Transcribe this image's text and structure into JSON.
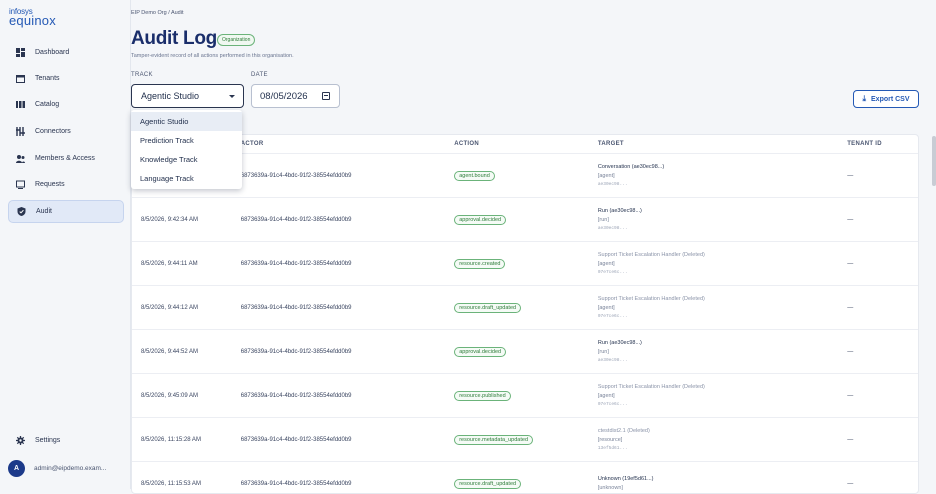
{
  "logo": {
    "line1": "infosys",
    "line2": "equinox"
  },
  "sidebar": {
    "items": [
      {
        "label": "Dashboard",
        "icon": "dashboard-icon"
      },
      {
        "label": "Tenants",
        "icon": "tenants-icon"
      },
      {
        "label": "Catalog",
        "icon": "catalog-icon"
      },
      {
        "label": "Connectors",
        "icon": "connectors-icon"
      },
      {
        "label": "Members & Access",
        "icon": "members-icon"
      },
      {
        "label": "Requests",
        "icon": "requests-icon"
      },
      {
        "label": "Audit",
        "icon": "shield-icon",
        "active": true
      }
    ],
    "settings": "Settings",
    "user": {
      "initial": "A",
      "email": "admin@eipdemo.exam..."
    }
  },
  "breadcrumb": "EIP Demo Org  /  Audit",
  "page": {
    "title": "Audit Log",
    "badge": "Organization",
    "subtitle": "Tamper-evident record of all actions performed in this organisation."
  },
  "filters": {
    "track_label": "TRACK",
    "track_value": "Agentic Studio",
    "date_label": "DATE",
    "date_value": "08/05/2026",
    "track_options": [
      "Agentic Studio",
      "Prediction Track",
      "Knowledge Track",
      "Language Track"
    ]
  },
  "export_label": "Export CSV",
  "table": {
    "headers": {
      "actor": "ACTOR",
      "action": "ACTION",
      "target": "TARGET",
      "tenant": "TENANT ID"
    },
    "rows": [
      {
        "time": "",
        "actor": "6873639a-91c4-4bdc-91f2-38554efdd0b9",
        "action": "agent.bound",
        "t1": "Conversation (ae30ec98...)",
        "t2": "[agent]",
        "t3": "ae30ec98...",
        "tenant": "—"
      },
      {
        "time": "8/5/2026, 9:42:34 AM",
        "actor": "6873639a-91c4-4bdc-91f2-38554efdd0b9",
        "action": "approval.decided",
        "t1": "Run (ae30ec98...)",
        "t2": "[run]",
        "t3": "ae30ec98...",
        "tenant": "—"
      },
      {
        "time": "8/5/2026, 9:44:11 AM",
        "actor": "6873639a-91c4-4bdc-91f2-38554efdd0b9",
        "action": "resource.created",
        "t1": "Support Ticket Escalation Handler (Deleted)",
        "t2": "[agent]",
        "t3": "07e7ce6c...",
        "tenant": "—",
        "deleted": true
      },
      {
        "time": "8/5/2026, 9:44:12 AM",
        "actor": "6873639a-91c4-4bdc-91f2-38554efdd0b9",
        "action": "resource.draft_updated",
        "t1": "Support Ticket Escalation Handler (Deleted)",
        "t2": "[agent]",
        "t3": "07e7ce6c...",
        "tenant": "—",
        "deleted": true
      },
      {
        "time": "8/5/2026, 9:44:52 AM",
        "actor": "6873639a-91c4-4bdc-91f2-38554efdd0b9",
        "action": "approval.decided",
        "t1": "Run (ae30ec98...)",
        "t2": "[run]",
        "t3": "ae30ec98...",
        "tenant": "—"
      },
      {
        "time": "8/5/2026, 9:45:09 AM",
        "actor": "6873639a-91c4-4bdc-91f2-38554efdd0b9",
        "action": "resource.published",
        "t1": "Support Ticket Escalation Handler (Deleted)",
        "t2": "[agent]",
        "t3": "07e7ce6c...",
        "tenant": "—",
        "deleted": true
      },
      {
        "time": "8/5/2026, 11:15:28 AM",
        "actor": "6873639a-91c4-4bdc-91f2-38554efdd0b9",
        "action": "resource.metadata_updated",
        "t1": "ctestdist2.1 (Deleted)",
        "t2": "[resource]",
        "t3": "13ef5d61...",
        "tenant": "—",
        "deleted": true
      },
      {
        "time": "8/5/2026, 11:15:53 AM",
        "actor": "6873639a-91c4-4bdc-91f2-38554efdd0b9",
        "action": "resource.draft_updated",
        "t1": "Unknown (19ef5d61...)",
        "t2": "[unknown]",
        "t3": "",
        "tenant": "—"
      }
    ]
  }
}
